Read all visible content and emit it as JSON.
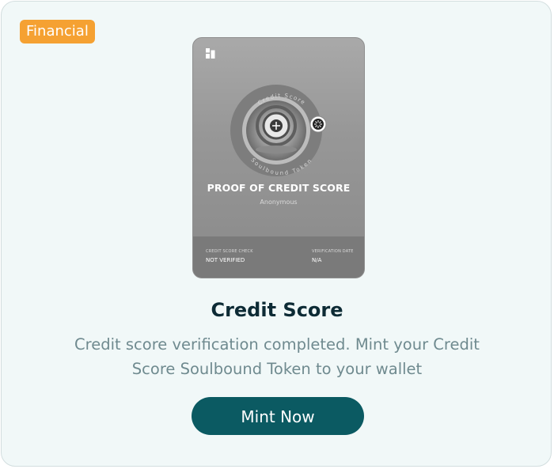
{
  "badge": {
    "label": "Financial",
    "color": "#f5a132"
  },
  "nft": {
    "ring_top_text": "Credit Score",
    "ring_bottom_text": "Soulbound Token",
    "title": "PROOF OF CREDIT SCORE",
    "subtitle": "Anonymous",
    "footer": {
      "check_label": "CREDIT SCORE CHECK",
      "check_value": "NOT VERIFIED",
      "date_label": "VERIFICATION DATE",
      "date_value": "N/A"
    }
  },
  "title": "Credit Score",
  "description_line1": "Credit score verification completed. Mint your Credit",
  "description_line2": "Score Soulbound Token to your wallet",
  "mint_button": {
    "label": "Mint Now",
    "color": "#0b5a62"
  }
}
